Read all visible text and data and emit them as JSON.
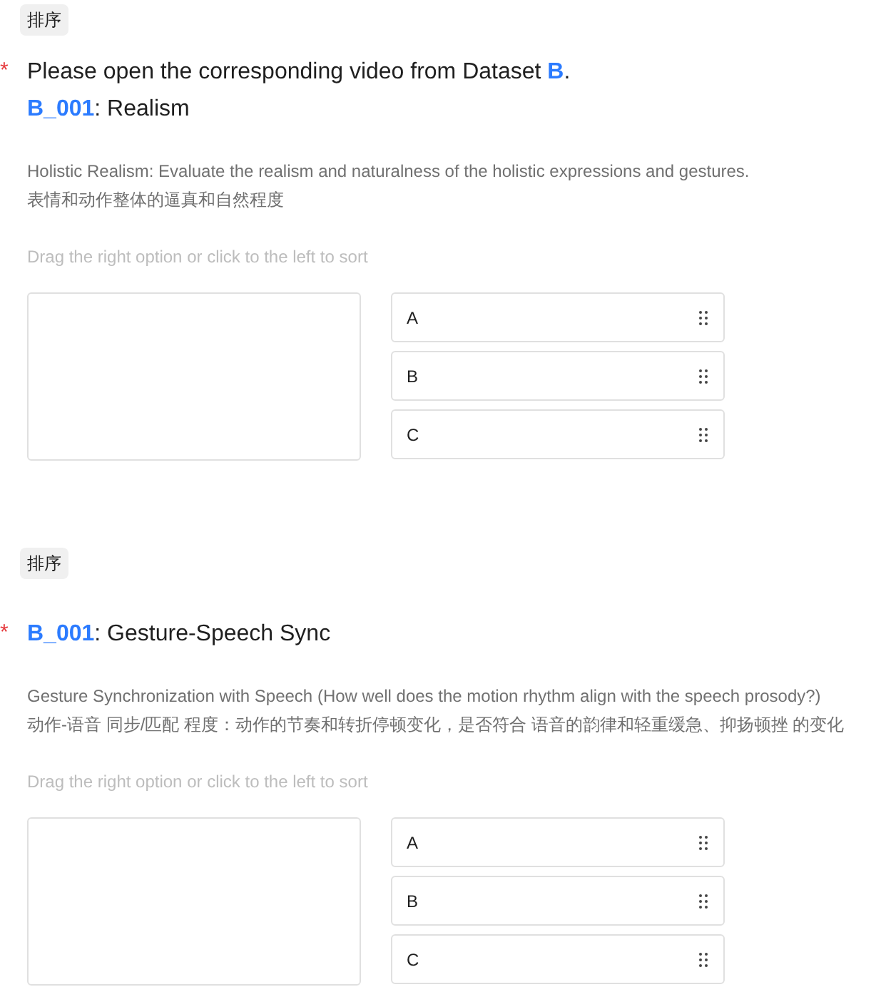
{
  "questions": [
    {
      "tag": "排序",
      "required_mark": "*",
      "title_lines": [
        "Please open the corresponding video from Dataset **B**.",
        "**B_001**: Realism"
      ],
      "description": [
        "Holistic Realism: Evaluate the realism and naturalness of the holistic expressions and gestures.",
        "表情和动作整体的逼真和自然程度"
      ],
      "hint": "Drag the right option or click to the left to sort",
      "options": [
        "A",
        "B",
        "C"
      ]
    },
    {
      "tag": "排序",
      "required_mark": "*",
      "title_lines": [
        "**B_001**: Gesture-Speech Sync"
      ],
      "description": [
        "Gesture Synchronization with Speech (How well does the motion rhythm align with the speech prosody?)",
        "动作-语音 同步/匹配 程度：动作的节奏和转折停顿变化，是否符合 语音的韵律和轻重缓急、抑扬顿挫 的变化"
      ],
      "hint": "Drag the right option or click to the left to sort",
      "options": [
        "A",
        "B",
        "C"
      ]
    }
  ]
}
